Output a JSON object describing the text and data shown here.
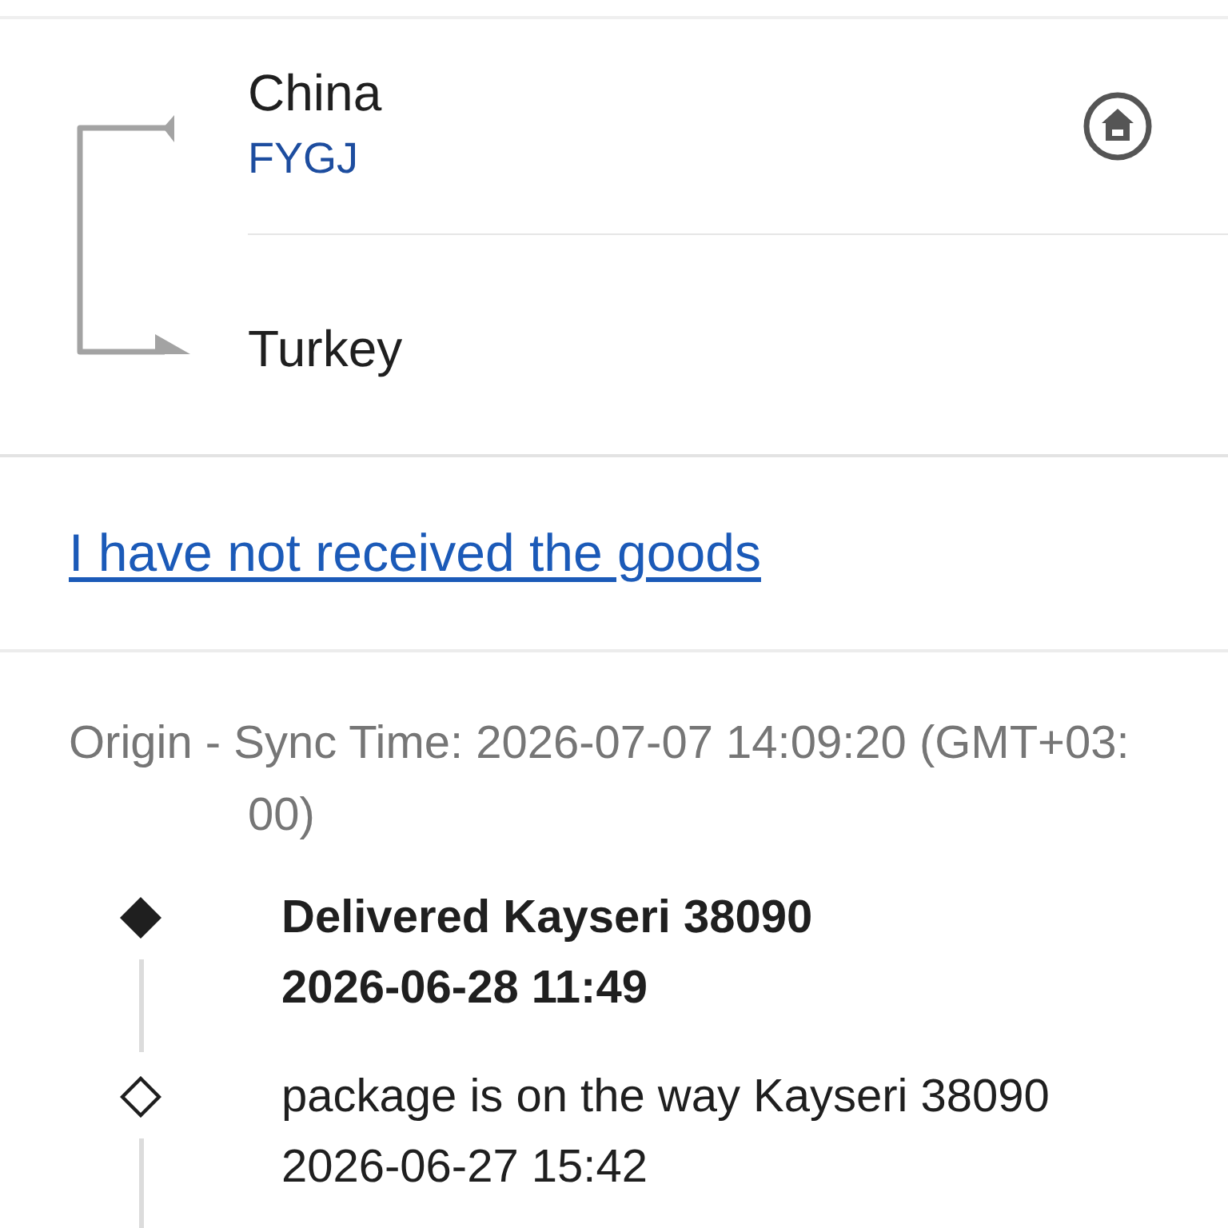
{
  "route": {
    "origin": "China",
    "carrier": "FYGJ",
    "destination": "Turkey"
  },
  "not_received_link": "I have not received the goods",
  "tracking": {
    "sync_time": "Origin - Sync Time: 2026-07-07 14:09:20 (GMT+03:00)",
    "events": [
      {
        "status": "Delivered Kayseri 38090",
        "time": "2026-06-28 11:49",
        "current": true
      },
      {
        "status": "package is on the way Kayseri 38090",
        "time": "2026-06-27 15:42",
        "current": false
      }
    ]
  }
}
